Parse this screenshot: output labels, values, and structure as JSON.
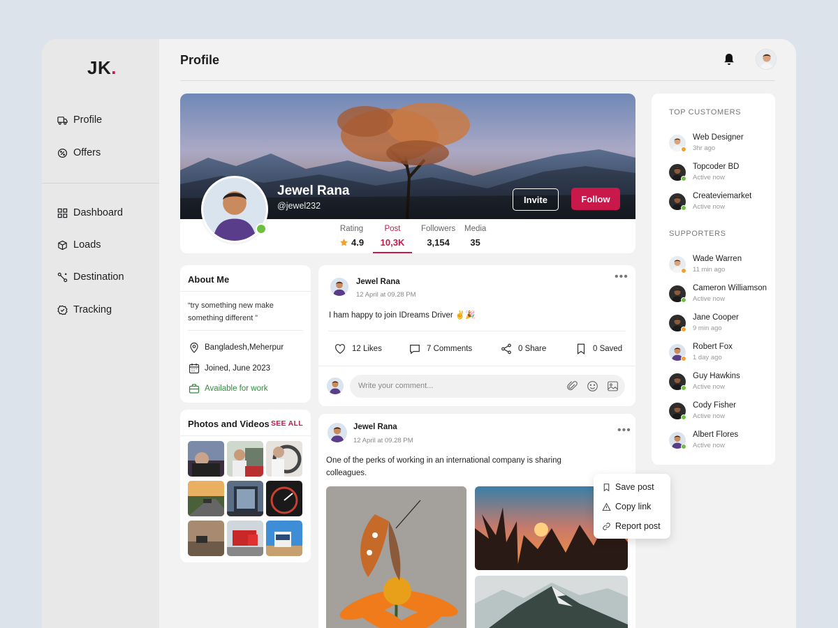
{
  "brand": {
    "logo_text": "JK",
    "logo_dot": "."
  },
  "sidebar": {
    "top_items": [
      {
        "label": "Profile",
        "icon": "truck-icon"
      },
      {
        "label": "Offers",
        "icon": "badge-percent-icon"
      }
    ],
    "items": [
      {
        "label": "Dashboard",
        "icon": "grid-icon"
      },
      {
        "label": "Loads",
        "icon": "box-icon"
      },
      {
        "label": "Destination",
        "icon": "route-icon"
      },
      {
        "label": "Tracking",
        "icon": "check-badge-icon"
      }
    ]
  },
  "header": {
    "title": "Profile",
    "notification_icon": "bell-icon"
  },
  "profile": {
    "name": "Jewel Rana",
    "handle": "@jewel232",
    "invite_label": "Invite",
    "follow_label": "Follow",
    "stats": [
      {
        "label": "Rating",
        "value": "4.9"
      },
      {
        "label": "Post",
        "value": "10,3K"
      },
      {
        "label": "Followers",
        "value": "3,154"
      },
      {
        "label": "Media",
        "value": "35"
      }
    ]
  },
  "about": {
    "title": "About Me",
    "quote": "“try something new make something different ”",
    "location": "Bangladesh,Meherpur",
    "joined": "Joined, June 2023",
    "availability": "Available for work"
  },
  "photos": {
    "title": "Photos and Videos",
    "see_all": "SEE ALL"
  },
  "post1": {
    "author": "Jewel Rana",
    "time": "12 April at 09.28 PM",
    "text": "I ham happy to join IDreams Driver ✌️🎉",
    "likes": "12 Likes",
    "comments": "7 Comments",
    "shares": "0 Share",
    "saved": "0 Saved",
    "comment_placeholder": "Write your comment..."
  },
  "post2": {
    "author": "Jewel Rana",
    "time": "12 April at 09.28 PM",
    "text_line1": "One of the perks of working in an international company is sharing",
    "text_line2": "colleagues."
  },
  "post_menu": {
    "items": [
      "Save post",
      "Copy link",
      "Report post"
    ]
  },
  "right_panel": {
    "top_customers_title": "TOP CUSTOMERS",
    "top_customers": [
      {
        "name": "Web Designer",
        "status": "3hr ago",
        "presence": "away"
      },
      {
        "name": "Topcoder BD",
        "status": "Active now",
        "presence": "online"
      },
      {
        "name": "Createviemarket",
        "status": "Active now",
        "presence": "online"
      }
    ],
    "supporters_title": "SUPPORTERS",
    "supporters": [
      {
        "name": "Wade Warren",
        "status": "11 min ago",
        "presence": "away"
      },
      {
        "name": "Cameron Williamson",
        "status": "Active now",
        "presence": "online"
      },
      {
        "name": "Jane Cooper",
        "status": "9 min ago",
        "presence": "away"
      },
      {
        "name": "Robert Fox",
        "status": "1 day ago",
        "presence": "away"
      },
      {
        "name": "Guy Hawkins",
        "status": "Active now",
        "presence": "online"
      },
      {
        "name": "Cody Fisher",
        "status": "Active now",
        "presence": "online"
      },
      {
        "name": "Albert Flores",
        "status": "Active now",
        "presence": "online"
      }
    ]
  },
  "colors": {
    "accent": "#c8194a",
    "online": "#6dbf3f",
    "away": "#f0a030",
    "success_text": "#2f8c3a"
  }
}
